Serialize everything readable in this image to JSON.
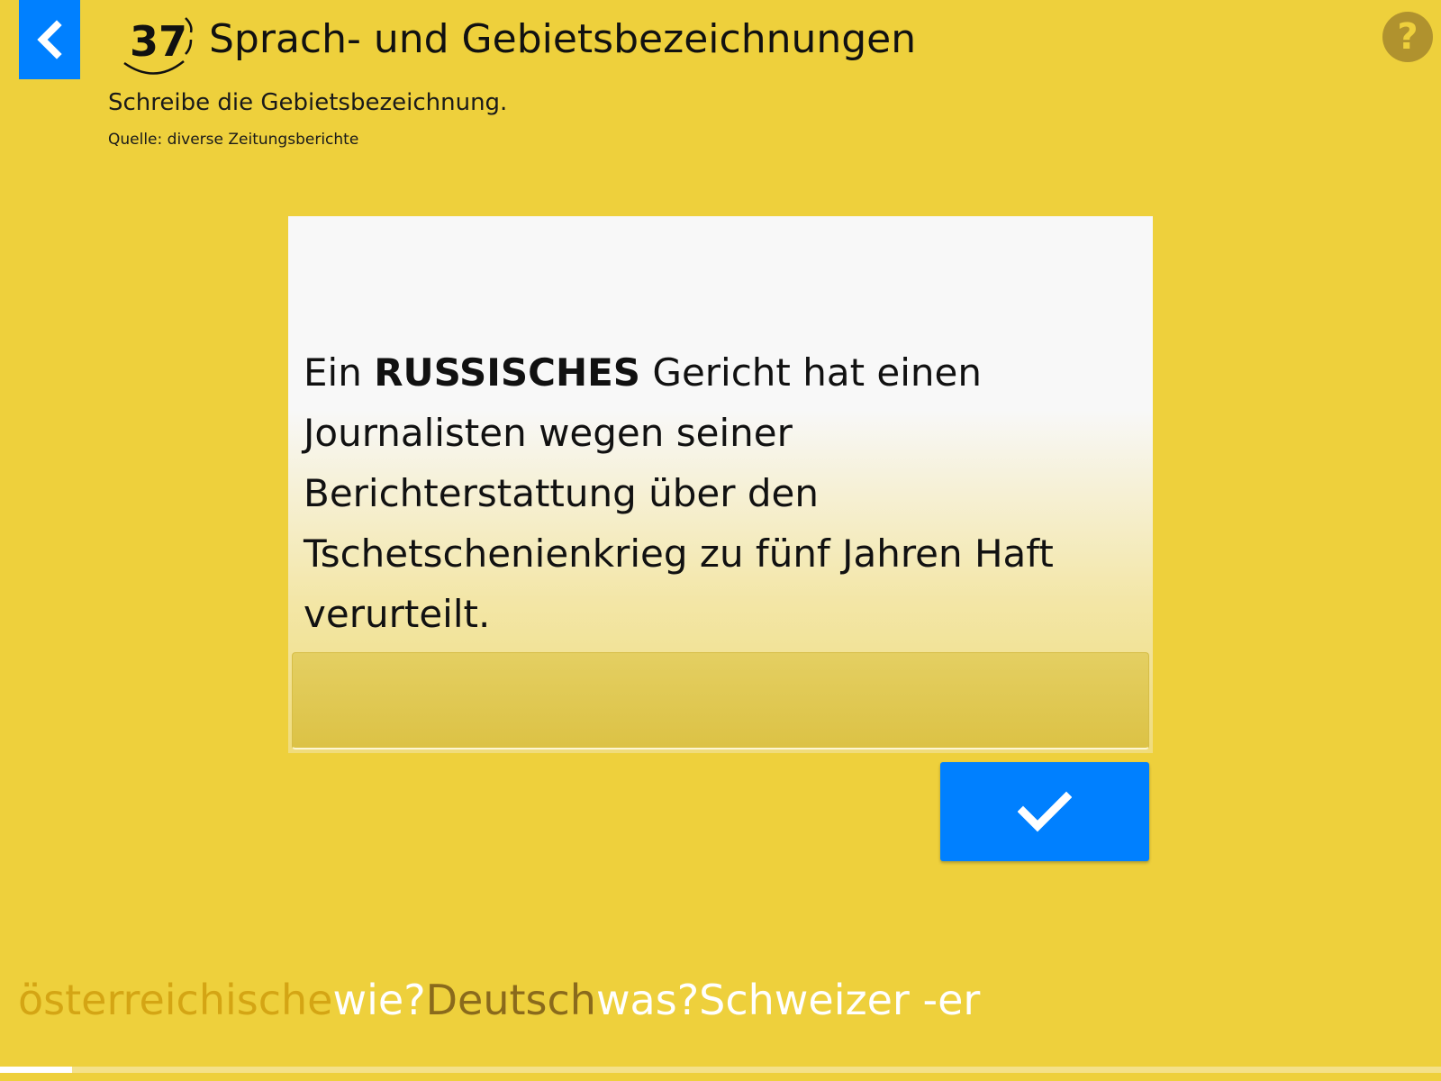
{
  "header": {
    "exercise_number": "37",
    "title": "Sprach- und Gebietsbezeichnungen",
    "instruction": "Schreibe die Gebietsbezeichnung.",
    "source": "Quelle: diverse Zeitungsberichte"
  },
  "colors": {
    "background": "#eed03c",
    "accent_blue": "#0080ff",
    "help_circle": "#b0922e"
  },
  "icons": {
    "back": "chevron-left-icon",
    "help": "question-mark-icon",
    "submit": "checkmark-icon"
  },
  "help_label": "?",
  "question": {
    "before": "Ein ",
    "emphasis": "RUSSISCHES",
    "after": " Gericht hat einen Journalisten wegen seiner Berichterstattung über den Tschetschenienkrieg zu fünf Jahren Haft verurteilt."
  },
  "answer": {
    "value": "",
    "placeholder": ""
  },
  "history": [
    {
      "word": "österreichische",
      "word_color": "#d4a514",
      "question": "wie?"
    },
    {
      "word": "Deutsch",
      "word_color": "#8a6a1c",
      "question": "was?"
    },
    {
      "word": "Schweizer -er",
      "word_color": "#ffffff",
      "question": ""
    }
  ],
  "progress": 0.05
}
